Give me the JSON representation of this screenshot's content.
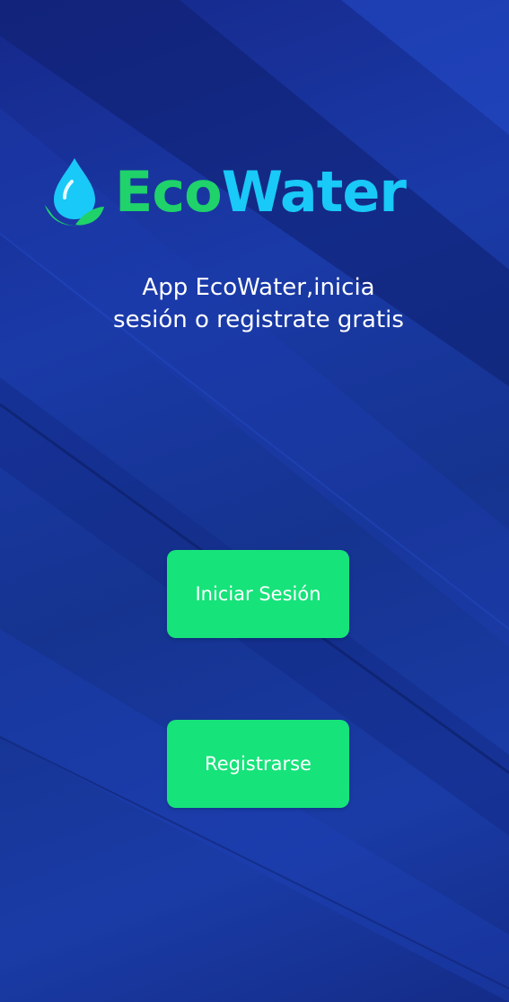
{
  "app": {
    "brand_part1": "Eco",
    "brand_part2": "Water",
    "subtitle_line1": "App EcoWater,inicia",
    "subtitle_line2": "sesión o registrate gratis"
  },
  "actions": {
    "login_label": "Iniciar Sesión",
    "register_label": "Registrarse"
  },
  "icons": {
    "logo": "water-drop-leaf-icon"
  },
  "colors": {
    "background": "#1a3aa8",
    "brand_green": "#1fd26a",
    "brand_blue": "#19c9f7",
    "button": "#16e37a",
    "text": "#ffffff"
  }
}
